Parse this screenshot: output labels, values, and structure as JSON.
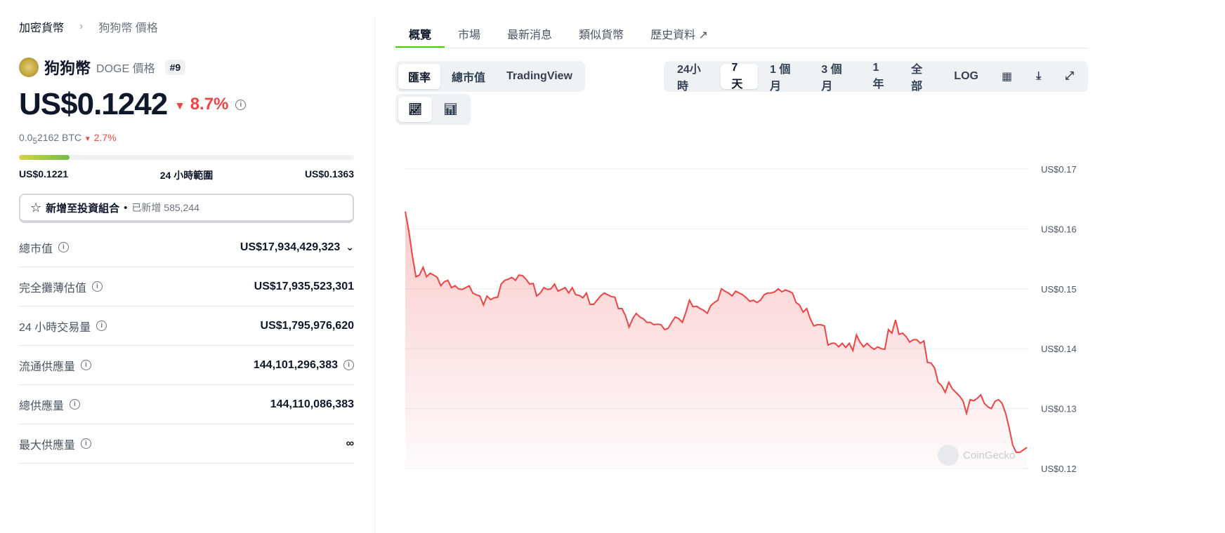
{
  "breadcrumb": {
    "root": "加密貨幣",
    "current": "狗狗幣 價格"
  },
  "coin": {
    "name": "狗狗幣",
    "symbol_label": "DOGE 價格",
    "rank": "#9"
  },
  "price": {
    "value": "US$0.1242",
    "change": "8.7%",
    "btc_prefix": "0.0",
    "btc_sub": "5",
    "btc_rest": "2162 BTC",
    "btc_change": "2.7%"
  },
  "range": {
    "low": "US$0.1221",
    "label": "24 小時範圍",
    "high": "US$0.1363",
    "position_pct": 15
  },
  "portfolio": {
    "label": "新增至投資組合",
    "added": "已新增 585,244"
  },
  "stats": [
    {
      "label": "總市值",
      "value": "US$17,934,429,323"
    },
    {
      "label": "完全攤薄估值",
      "value": "US$17,935,523,301"
    },
    {
      "label": "24 小時交易量",
      "value": "US$1,795,976,620"
    },
    {
      "label": "流通供應量",
      "value": "144,101,296,383"
    },
    {
      "label": "總供應量",
      "value": "144,110,086,383"
    },
    {
      "label": "最大供應量",
      "value": "∞"
    }
  ],
  "tabs": [
    "概覽",
    "市場",
    "最新消息",
    "類似貨幣",
    "歷史資料"
  ],
  "chart_types": [
    "匯率",
    "總市值",
    "TradingView"
  ],
  "ranges": [
    "24小時",
    "7天",
    "1 個月",
    "3 個月",
    "1年",
    "全部",
    "LOG"
  ],
  "watermark": "CoinGecko",
  "colors": {
    "line": "#ef4444",
    "accent": "#4bcc00"
  },
  "chart_data": {
    "type": "area",
    "title": "DOGE 7天 匯率",
    "ylim": [
      0.12,
      0.17
    ],
    "yticks": [
      "US$0.17",
      "US$0.16",
      "US$0.15",
      "US$0.14",
      "US$0.13",
      "US$0.12"
    ],
    "ytick_values": [
      0.17,
      0.16,
      0.15,
      0.14,
      0.13,
      0.12
    ],
    "values": [
      0.1629,
      0.1596,
      0.1555,
      0.152,
      0.1523,
      0.1536,
      0.152,
      0.1526,
      0.1523,
      0.1519,
      0.1505,
      0.1512,
      0.1514,
      0.1502,
      0.1505,
      0.15,
      0.1499,
      0.1502,
      0.1505,
      0.1493,
      0.149,
      0.1488,
      0.1473,
      0.1488,
      0.1482,
      0.1485,
      0.1486,
      0.1508,
      0.1514,
      0.1516,
      0.1519,
      0.1514,
      0.1523,
      0.1522,
      0.1516,
      0.1508,
      0.1509,
      0.1488,
      0.1493,
      0.1502,
      0.1499,
      0.15,
      0.1508,
      0.1496,
      0.1499,
      0.1502,
      0.1493,
      0.1502,
      0.149,
      0.1489,
      0.1485,
      0.1493,
      0.1474,
      0.1474,
      0.1481,
      0.1488,
      0.1493,
      0.149,
      0.1487,
      0.1486,
      0.1467,
      0.1467,
      0.1455,
      0.1436,
      0.145,
      0.1459,
      0.1453,
      0.145,
      0.1444,
      0.1444,
      0.144,
      0.1441,
      0.144,
      0.1432,
      0.1434,
      0.1444,
      0.1453,
      0.145,
      0.1444,
      0.1461,
      0.1481,
      0.147,
      0.1471,
      0.1467,
      0.1464,
      0.1459,
      0.1472,
      0.1477,
      0.1481,
      0.15,
      0.1496,
      0.1493,
      0.1488,
      0.1496,
      0.1493,
      0.149,
      0.1485,
      0.1479,
      0.1481,
      0.1477,
      0.1481,
      0.149,
      0.1493,
      0.1493,
      0.1495,
      0.15,
      0.1495,
      0.1498,
      0.1496,
      0.1493,
      0.1477,
      0.1473,
      0.1461,
      0.1467,
      0.145,
      0.1438,
      0.144,
      0.144,
      0.1438,
      0.1406,
      0.1409,
      0.1409,
      0.1403,
      0.1409,
      0.1402,
      0.1409,
      0.1397,
      0.1423,
      0.1411,
      0.1403,
      0.1409,
      0.1403,
      0.1399,
      0.1403,
      0.14,
      0.1399,
      0.1432,
      0.1426,
      0.1448,
      0.1424,
      0.1426,
      0.142,
      0.1411,
      0.1415,
      0.1415,
      0.1409,
      0.1413,
      0.1377,
      0.1376,
      0.1368,
      0.1344,
      0.1338,
      0.1327,
      0.1344,
      0.1333,
      0.1327,
      0.1321,
      0.1313,
      0.1292,
      0.1315,
      0.1313,
      0.1317,
      0.1323,
      0.1309,
      0.1303,
      0.13,
      0.1312,
      0.1315,
      0.1309,
      0.1292,
      0.1268,
      0.1239,
      0.1227,
      0.1227,
      0.1231,
      0.1235
    ]
  }
}
